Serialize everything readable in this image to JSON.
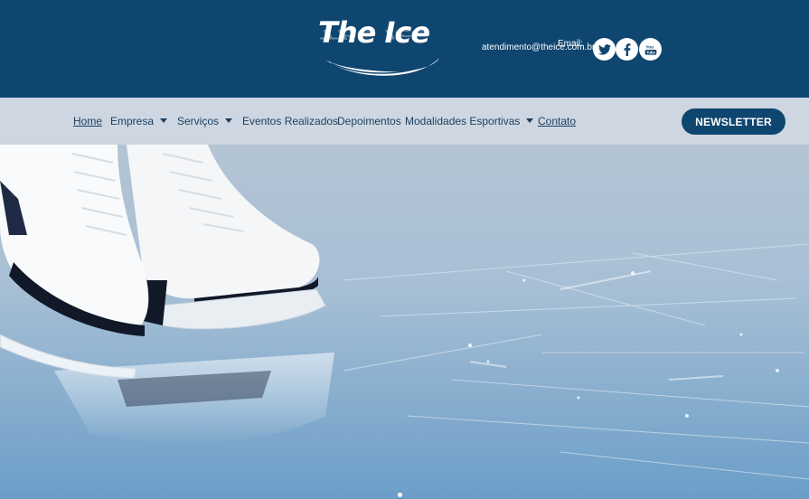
{
  "header": {
    "logo_text": "The Ice",
    "email_label": "Email:",
    "email_value": "atendimento@theice.com.br",
    "social": [
      {
        "name": "twitter",
        "icon": "twitter-icon",
        "glyph": "t"
      },
      {
        "name": "facebook",
        "icon": "facebook-icon",
        "glyph": "f"
      },
      {
        "name": "youtube",
        "icon": "youtube-icon",
        "glyph": "You"
      }
    ]
  },
  "nav": {
    "items": [
      {
        "label": "Home",
        "dropdown": false
      },
      {
        "label": "Empresa",
        "dropdown": true
      },
      {
        "label": "Serviços",
        "dropdown": true
      },
      {
        "label": "Eventos Realizados",
        "dropdown": false
      },
      {
        "label": "Depoimentos",
        "dropdown": false
      },
      {
        "label": "Modalidades Esportivas",
        "dropdown": true
      },
      {
        "label": "Contato",
        "dropdown": false
      }
    ],
    "newsletter_label": "NEWSLETTER"
  },
  "hero": {
    "image": "ice-skates-on-ice"
  },
  "colors": {
    "brand": "#0f4670",
    "nav_bg": "#cdd6e1",
    "nav_text": "#1c3f5f"
  }
}
